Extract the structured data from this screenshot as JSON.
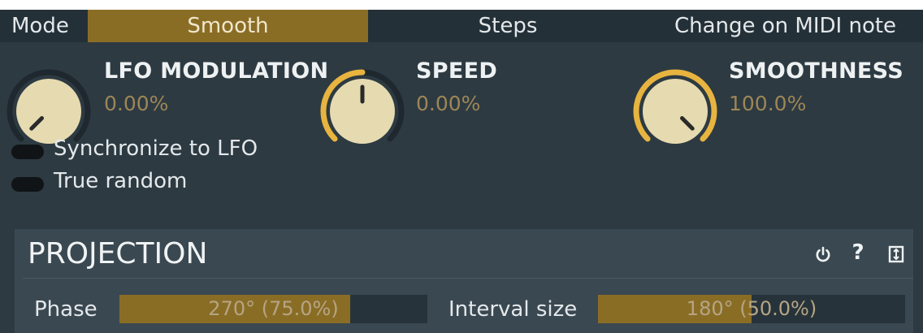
{
  "mode": {
    "label": "Mode",
    "tabs": [
      {
        "label": "Smooth",
        "active": true
      },
      {
        "label": "Steps",
        "active": false
      },
      {
        "label": "Change on MIDI note",
        "active": false
      }
    ]
  },
  "knobs": [
    {
      "title": "LFO MODULATION",
      "value": "0.00%",
      "level": 0.0
    },
    {
      "title": "SPEED",
      "value": "0.00%",
      "level": 0.5
    },
    {
      "title": "SMOOTHNESS",
      "value": "100.0%",
      "level": 1.0
    }
  ],
  "toggles": [
    {
      "label": "Synchronize to LFO",
      "on": false
    },
    {
      "label": "True random",
      "on": false
    }
  ],
  "projection": {
    "title": "PROJECTION",
    "icons": [
      "power-icon",
      "help-icon",
      "expand-icon"
    ],
    "help_glyph": "?",
    "phase": {
      "label": "Phase",
      "value": "270° (75.0%)",
      "fraction": 0.75
    },
    "interval": {
      "label": "Interval size",
      "value": "180° (50.0%)",
      "fraction": 0.5
    }
  },
  "colors": {
    "accent": "#8a6d25",
    "value_text": "#9d8656",
    "arc_active": "#e8b440",
    "background": "#2d3a42"
  }
}
